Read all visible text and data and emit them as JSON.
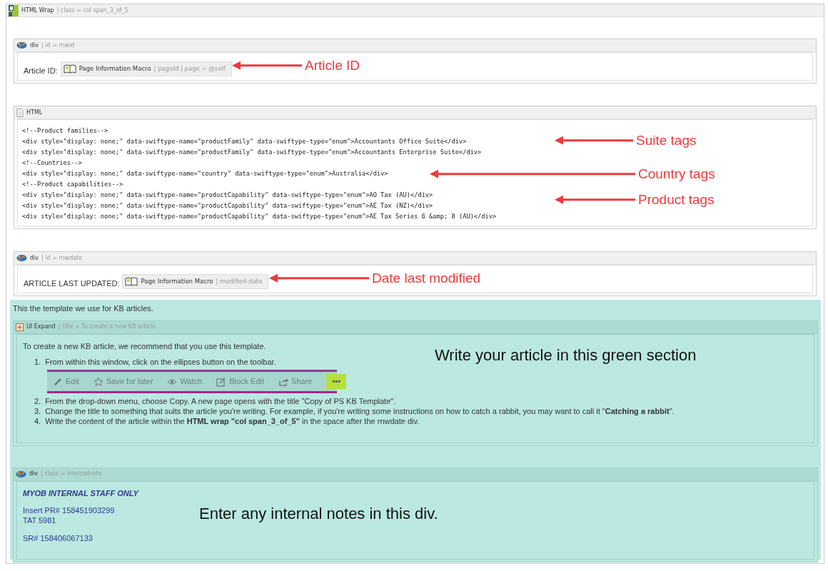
{
  "wrap": {
    "name": "HTML Wrap",
    "params": "| class = col span_3_of_5"
  },
  "article_id": {
    "name": "div",
    "params": "| id = rnwid",
    "label": "Article ID:",
    "macro": {
      "name": "Page Information Macro",
      "params": "| pageId | page = @self"
    },
    "annotation": "Article ID"
  },
  "html_block": {
    "name": "HTML",
    "lines": [
      {
        "text": "<!--Product families-->"
      },
      {
        "text": "<div style=\"display: none;\" data-swiftype-name=\"productFamily\" data-swiftype-type=\"enum\">Accountants Office Suite</div>",
        "annotation": "Suite tags"
      },
      {
        "text": "<div style=\"display: none;\" data-swiftype-name=\"productFamily\" data-swiftype-type=\"enum\">Accountants Enterprise Suite</div>"
      },
      {
        "text": "<!--Countries-->"
      },
      {
        "text": "<div style=\"display: none;\" data-swiftype-name=\"country\" data-swiftype-type=\"enum\">Australia</div>",
        "annotation": "Country tags"
      },
      {
        "text": "<!--Product capabilities-->"
      },
      {
        "text": "<div style=\"display: none;\" data-swiftype-name=\"productCapability\" data-swiftype-type=\"enum\">AO Tax (AU)</div>",
        "annotation": "Product tags"
      },
      {
        "text": "<div style=\"display: none;\" data-swiftype-name=\"productCapability\" data-swiftype-type=\"enum\">AE Tax (NZ)</div>"
      },
      {
        "text": "<div style=\"display: none;\" data-swiftype-name=\"productCapability\" data-swiftype-type=\"enum\">AE Tax Series 6 &amp; 8 (AU)</div>"
      }
    ]
  },
  "date_block": {
    "name": "div",
    "params": "| id = rnwdate",
    "label": "ARTICLE LAST UPDATED:",
    "macro": {
      "name": "Page Information Macro",
      "params": "| modified-date"
    },
    "annotation": "Date last modified"
  },
  "green": {
    "intro": "This the template we use for KB articles.",
    "expand": {
      "name": "UI Expand",
      "params": "| title = To create a new KB article",
      "lead": "To create a new KB article, we recommend that you use this template.",
      "steps": [
        {
          "number": "1.",
          "text": "From within this window, click on the ellipses button on the toolbar."
        },
        {
          "number": "2.",
          "text": "From the drop-down menu, choose Copy. A new page opens with the title \"Copy of PS KB Template\"."
        },
        {
          "number": "3.",
          "text": "Change the title to something that suits the article you're writing. For example, if you're writing some instructions on how to catch a rabbit, you may want to call it \"**Catching a rabbit**\"."
        },
        {
          "number": "4.",
          "text": "Write the content of the article within the **HTML wrap \"col span_3_of_5\"** in the space after the rnwdate div."
        }
      ],
      "toolbar": [
        {
          "kind": "edit",
          "label": "Edit",
          "highlighted": false
        },
        {
          "kind": "star",
          "label": "Save for later",
          "highlighted": false
        },
        {
          "kind": "watch",
          "label": "Watch",
          "highlighted": false
        },
        {
          "kind": "block",
          "label": "Block Edit",
          "highlighted": false
        },
        {
          "kind": "share",
          "label": "Share",
          "highlighted": false
        },
        {
          "kind": "more",
          "label": "•••",
          "highlighted": true
        }
      ],
      "annotation": "Write your article in this green section"
    },
    "note": {
      "name": "div",
      "params": "| class = internalnote",
      "title": "MYOB INTERNAL STAFF ONLY",
      "groups": [
        [
          "Insert PR# 158451903299",
          "TAT 5981"
        ],
        [
          "SR# 158406067133"
        ]
      ],
      "annotation": "Enter any internal notes in this div."
    }
  }
}
